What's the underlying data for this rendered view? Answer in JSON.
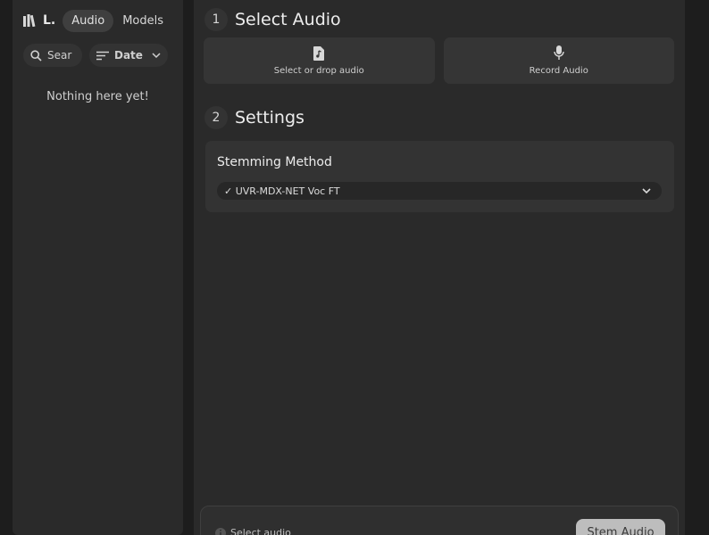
{
  "library": {
    "title": "L.",
    "tabs": [
      {
        "label": "Audio",
        "active": true
      },
      {
        "label": "Models",
        "active": false
      }
    ],
    "search": {
      "placeholder": "Sear",
      "value": ""
    },
    "sort": {
      "label": "Date"
    },
    "empty_message": "Nothing here yet!"
  },
  "steps": {
    "select": {
      "number": "1",
      "title": "Select Audio",
      "buttons": [
        {
          "label": "Select or drop audio",
          "icon": "audio-file-icon"
        },
        {
          "label": "Record Audio",
          "icon": "microphone-icon"
        }
      ]
    },
    "settings": {
      "number": "2",
      "title": "Settings",
      "stemming_label": "Stemming Method",
      "method_value": "✓ UVR-MDX-NET Voc FT"
    }
  },
  "bottom": {
    "status": "Select audio",
    "action_label": "Stem Audio"
  },
  "colors": {
    "background": "#1d1d1d",
    "panel": "#2a2a2a",
    "card": "#353535",
    "action_disabled": "#bdbdbd"
  }
}
